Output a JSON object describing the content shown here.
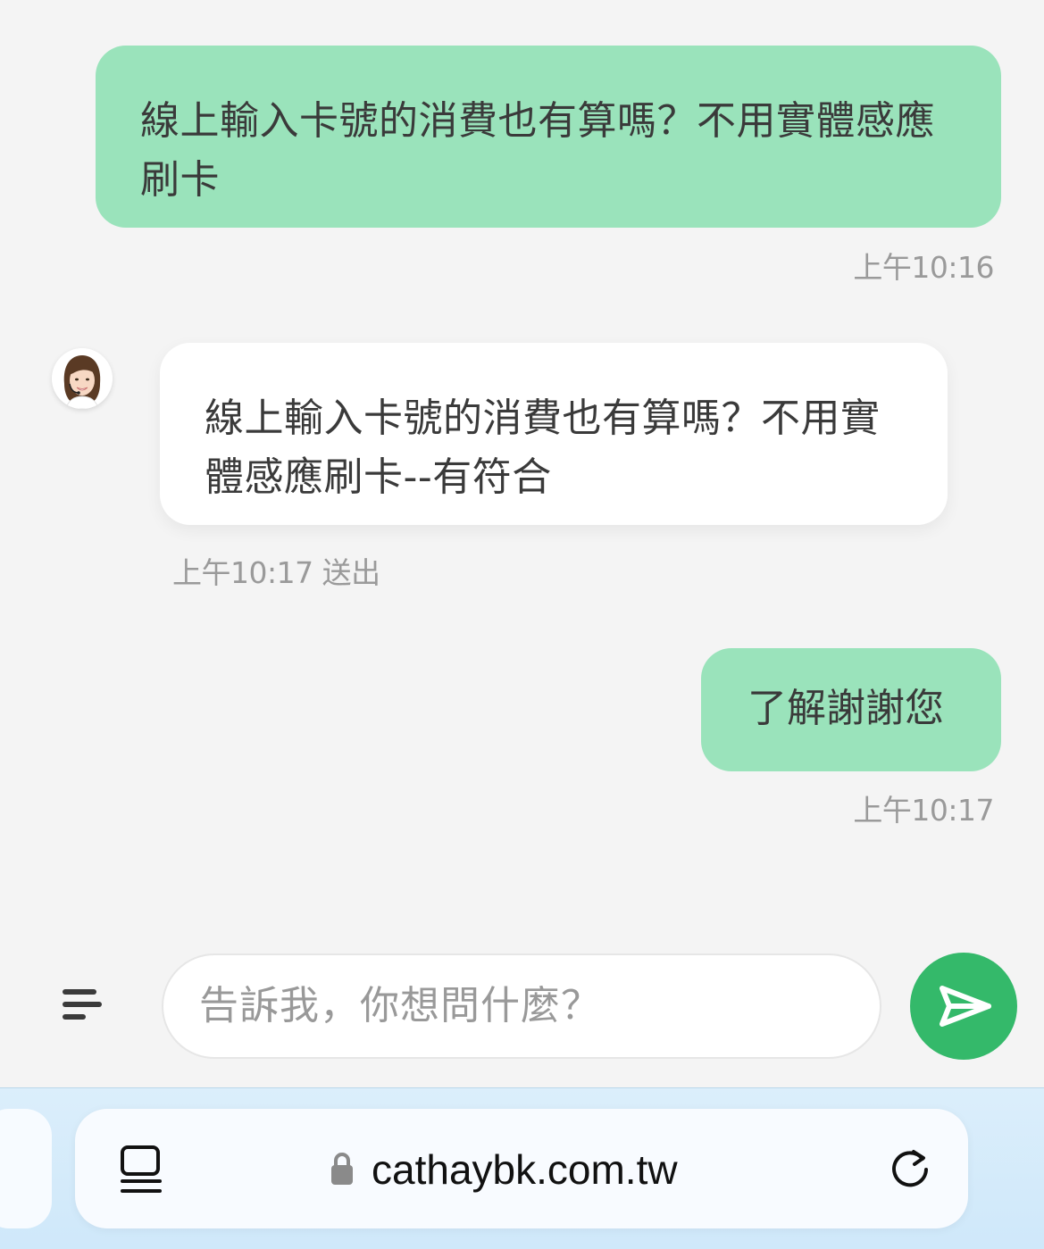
{
  "messages": [
    {
      "sender": "user",
      "text": "線上輸入卡號的消費也有算嗎？不用實體感應刷卡",
      "time": "上午10:16"
    },
    {
      "sender": "bot",
      "text": "線上輸入卡號的消費也有算嗎？不用實體感應刷卡--有符合",
      "time": "上午10:17 送出"
    },
    {
      "sender": "user",
      "text": "了解謝謝您",
      "time": "上午10:17"
    }
  ],
  "composer": {
    "placeholder": "告訴我，你想問什麼？",
    "menu_icon": "menu-lines-icon",
    "send_icon": "send-arrow-icon"
  },
  "browser": {
    "url": "cathaybk.com.tw",
    "lock_icon": "lock-icon",
    "tabs_icon": "tabs-icon",
    "reload_icon": "reload-icon"
  },
  "colors": {
    "user_bubble": "#9ae3bb",
    "bot_bubble": "#ffffff",
    "send_button": "#34b96a",
    "background": "#f4f4f4"
  }
}
